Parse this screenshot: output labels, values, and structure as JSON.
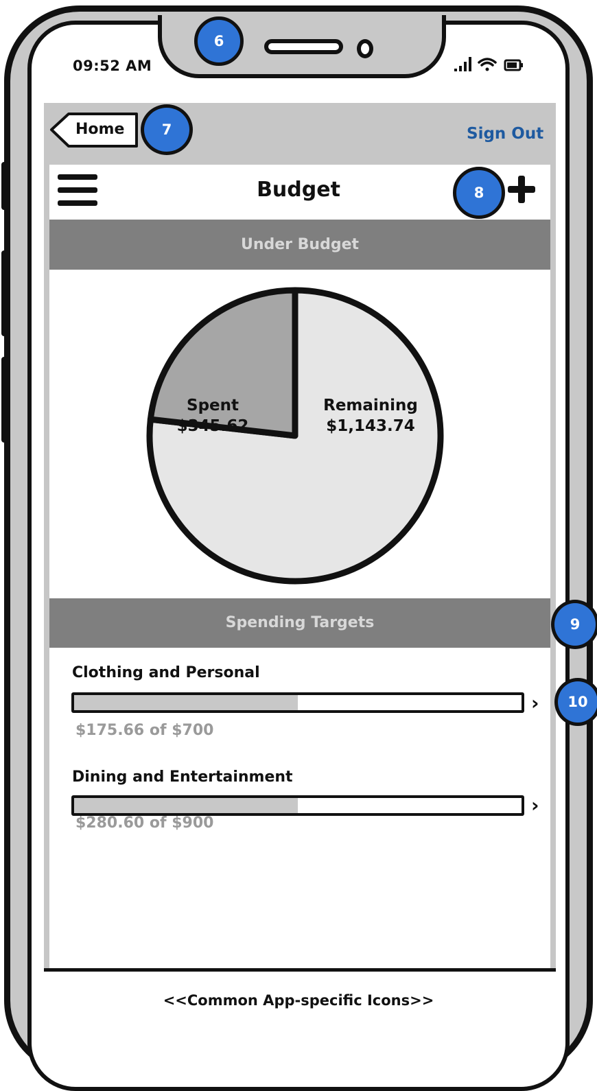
{
  "status_bar": {
    "time": "09:52 AM"
  },
  "nav": {
    "back_label": "Home",
    "sign_out": "Sign Out"
  },
  "header": {
    "title": "Budget"
  },
  "sections": {
    "under_budget": "Under Budget",
    "spending_targets": "Spending Targets"
  },
  "chart_data": {
    "type": "pie",
    "slices": [
      {
        "label": "Spent",
        "value_label": "$345.62",
        "value": 345.62,
        "color": "#a6a6a6"
      },
      {
        "label": "Remaining",
        "value_label": "$1,143.74",
        "value": 1143.74,
        "color": "#e6e6e6"
      }
    ]
  },
  "targets": [
    {
      "name": "Clothing and Personal",
      "amount": "$175.66 of $700",
      "progress": 0.5
    },
    {
      "name": "Dining and Entertainment",
      "amount": "$280.60 of $900",
      "progress": 0.5
    }
  ],
  "footer": {
    "text": "<<Common App-specific Icons>>"
  },
  "callouts": [
    "6",
    "7",
    "8",
    "9",
    "10"
  ],
  "colors": {
    "accent": "#1e5aa0",
    "callout": "#2f74d6",
    "section_header": "#7f7f7f"
  }
}
